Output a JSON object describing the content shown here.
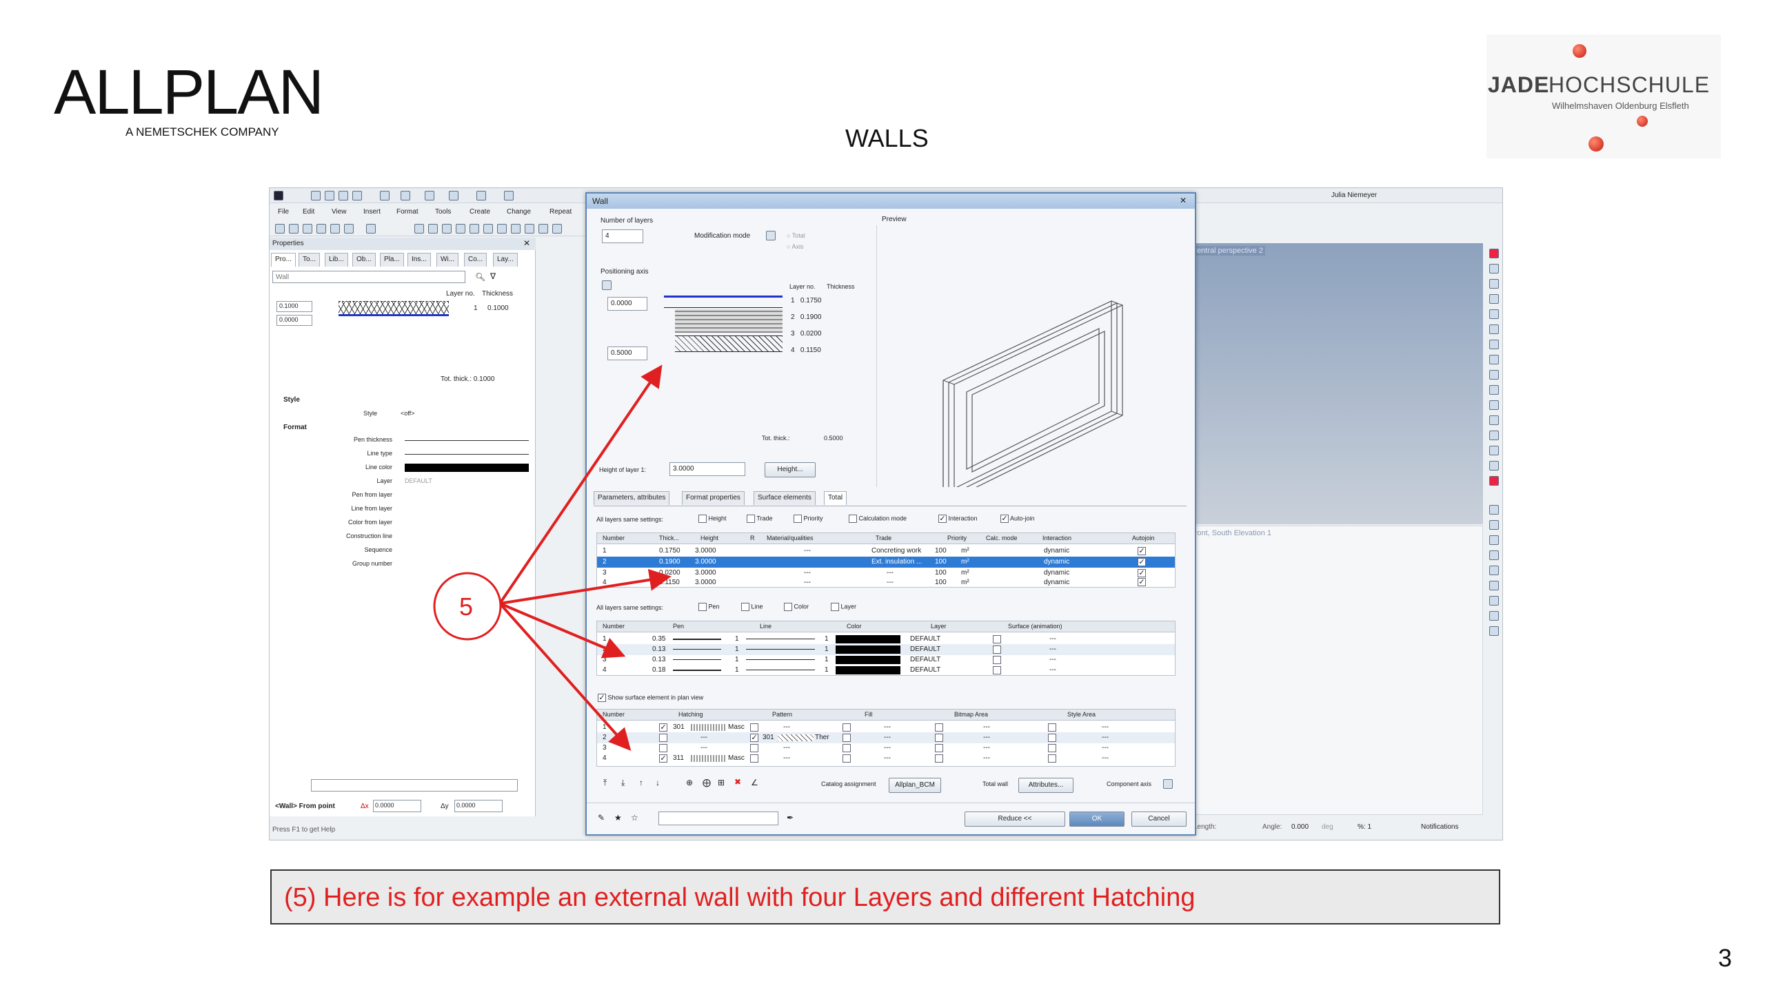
{
  "slide": {
    "logo_main": "ALLPLAN",
    "logo_sub": "A NEMETSCHEK COMPANY",
    "title": "WALLS",
    "school_jade": "JADE",
    "school_name": "HOCHSCHULE",
    "school_sub": "Wilhelmshaven Oldenburg Elsfleth",
    "page_number": "3",
    "callout_number": "5",
    "caption": "(5) Here is for example an external wall with four Layers and different Hatching",
    "accent_color": "#e02020"
  },
  "app": {
    "menu": [
      "File",
      "Edit",
      "View",
      "Insert",
      "Format",
      "Tools",
      "Create",
      "Change",
      "Repeat"
    ],
    "user": "Julia Niemeyer",
    "status_help": "Press F1 to get Help",
    "status_length": "Length:",
    "status_angle": "Angle:",
    "status_angle_value": "0.000",
    "status_deg": "deg",
    "status_percent": "%: 1",
    "status_notifications": "Notifications",
    "viewport_label_1": "Central perspective 2",
    "viewport_label_2": "Front, South Elevation 1"
  },
  "properties": {
    "title": "Properties",
    "tabs": [
      "Pro...",
      "To...",
      "Lib...",
      "Ob...",
      "Pla...",
      "Ins...",
      "Wi...",
      "Co...",
      "Lay..."
    ],
    "filter_placeholder": "Wall",
    "layer_no_label": "Layer no.",
    "thickness_label": "Thickness",
    "value1": "0.1000",
    "value2": "0.0000",
    "layer_row": "1",
    "layer_row_thick": "0.1000",
    "total_thick": "Tot. thick.: 0.1000",
    "style_section": "Style",
    "style_label": "Style",
    "style_value": "<off>",
    "format_section": "Format",
    "format_rows": [
      "Pen thickness",
      "Line type",
      "Line color",
      "Layer",
      "Pen from layer",
      "Line from layer",
      "Color from layer",
      "Construction line",
      "Sequence",
      "Group number"
    ],
    "layer_value": "DEFAULT",
    "wall_from_point": "<Wall> From point",
    "dx_label": "Δx",
    "dx_value": "0.0000",
    "dy_label": "Δy",
    "dy_value": "0.0000"
  },
  "dialog": {
    "title": "Wall",
    "number_of_layers_label": "Number of layers",
    "number_of_layers_value": "4",
    "modification_mode_label": "Modification mode",
    "mode_total": "Total",
    "mode_axis": "Axis",
    "positioning_axis_label": "Positioning axis",
    "axis_val1": "0.0000",
    "axis_val2": "0.5000",
    "layer_no_label": "Layer no.",
    "thickness_label": "Thickness",
    "layers": [
      {
        "no": "1",
        "t": "0.1750"
      },
      {
        "no": "2",
        "t": "0.1900"
      },
      {
        "no": "3",
        "t": "0.0200"
      },
      {
        "no": "4",
        "t": "0.1150"
      }
    ],
    "total_thick_label": "Tot. thick.:",
    "total_thick_value": "0.5000",
    "height_of_layer_label": "Height of layer 1:",
    "height_of_layer_value": "3.0000",
    "height_button": "Height...",
    "preview_label": "Preview",
    "tabs": [
      "Parameters, attributes",
      "Format properties",
      "Surface elements",
      "Total"
    ],
    "same_settings_label": "All layers same settings:",
    "same1": [
      "Height",
      "Trade",
      "Priority",
      "Calculation mode",
      "Interaction",
      "Auto-join"
    ],
    "grid1_headers": [
      "Number",
      "Thick...",
      "Height",
      "",
      "R",
      "Material/qualities",
      "Trade",
      "Priority",
      "Calc. mode",
      "Interaction",
      "Autojoin"
    ],
    "grid1_rows": [
      [
        "1",
        "0.1750",
        "3.0000",
        "---",
        "Concreting work",
        "100",
        "m²",
        "dynamic"
      ],
      [
        "2",
        "0.1900",
        "3.0000",
        "Ext. insulation ...",
        "100",
        "m²",
        "dynamic",
        ""
      ],
      [
        "3",
        "0.0200",
        "3.0000",
        "---",
        "---",
        "100",
        "m²",
        "dynamic"
      ],
      [
        "4",
        "0.1150",
        "3.0000",
        "---",
        "---",
        "100",
        "m²",
        "dynamic"
      ]
    ],
    "same2": [
      "Pen",
      "Line",
      "Color",
      "Layer"
    ],
    "grid2_headers": [
      "Number",
      "Pen",
      "Line",
      "Color",
      "Layer",
      "Surface (animation)"
    ],
    "grid2_rows": [
      {
        "n": "1",
        "pen": "0.35",
        "line": "1",
        "color": "1",
        "layer": "DEFAULT",
        "surf": "---"
      },
      {
        "n": "2",
        "pen": "0.13",
        "line": "1",
        "color": "1",
        "layer": "DEFAULT",
        "surf": "---"
      },
      {
        "n": "3",
        "pen": "0.13",
        "line": "1",
        "color": "1",
        "layer": "DEFAULT",
        "surf": "---"
      },
      {
        "n": "4",
        "pen": "0.18",
        "line": "1",
        "color": "1",
        "layer": "DEFAULT",
        "surf": "---"
      }
    ],
    "show_surface_label": "Show surface element in plan view",
    "grid3_headers": [
      "Number",
      "Hatching",
      "Pattern",
      "Fill",
      "Bitmap Area",
      "Style Area"
    ],
    "grid3_rows": [
      {
        "n": "1",
        "hatch": "301",
        "hname": "Masc",
        "pattern": "---",
        "fill": "---",
        "bitmap": "---",
        "style": "---"
      },
      {
        "n": "2",
        "hatch": "---",
        "hname": "",
        "pattern": "301",
        "pname": "Ther",
        "fill": "---",
        "bitmap": "---",
        "style": "---"
      },
      {
        "n": "3",
        "hatch": "---",
        "hname": "",
        "pattern": "---",
        "fill": "---",
        "bitmap": "---",
        "style": "---"
      },
      {
        "n": "4",
        "hatch": "311",
        "hname": "Masc",
        "pattern": "---",
        "fill": "---",
        "bitmap": "---",
        "style": "---"
      }
    ],
    "catalog_label": "Catalog assignment",
    "catalog_value": "Allplan_BCM",
    "total_wall_label": "Total wall",
    "attributes_button": "Attributes...",
    "component_axis_label": "Component axis",
    "reduce_button": "Reduce <<",
    "ok_button": "OK",
    "cancel_button": "Cancel"
  }
}
